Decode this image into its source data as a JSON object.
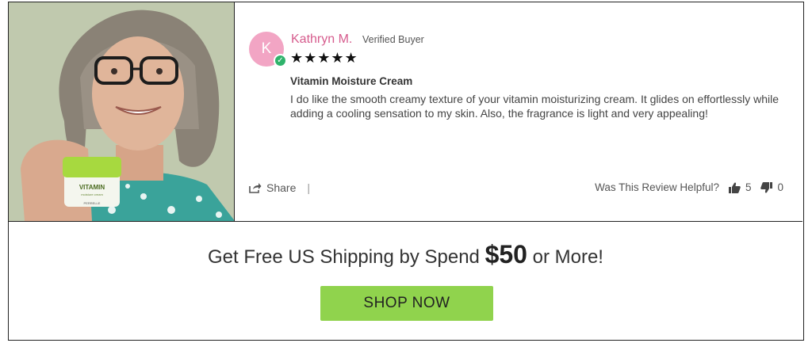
{
  "review": {
    "avatar_initial": "K",
    "reviewer_name": "Kathryn M.",
    "verified_label": "Verified Buyer",
    "rating_stars": "★★★★★",
    "rating": 5,
    "title": "Vitamin Moisture Cream",
    "body": "I do like the smooth creamy texture of your vitamin moisturizing cream. It glides on effortlessly while adding a cooling sensation to my skin. Also, the fragrance is light and very appealing!",
    "share_label": "Share",
    "share_separator": "|",
    "helpful_label": "Was This Review Helpful?",
    "upvotes": "5",
    "downvotes": "0"
  },
  "product_photo": {
    "jar_label": "VITAMIN",
    "jar_sublabel": "moisture cream",
    "jar_brand": "PERRELLE"
  },
  "promo": {
    "text_before": "Get Free US Shipping by Spend ",
    "amount": "$50",
    "text_after": " or More!",
    "button_label": "SHOP NOW"
  },
  "colors": {
    "reviewer_name": "#d65c8d",
    "avatar": "#f2a5c4",
    "verified_badge": "#2fb36b",
    "shop_button": "#90d34d"
  },
  "icons": [
    "verified-check-icon",
    "share-icon",
    "thumbs-up-icon",
    "thumbs-down-icon"
  ]
}
